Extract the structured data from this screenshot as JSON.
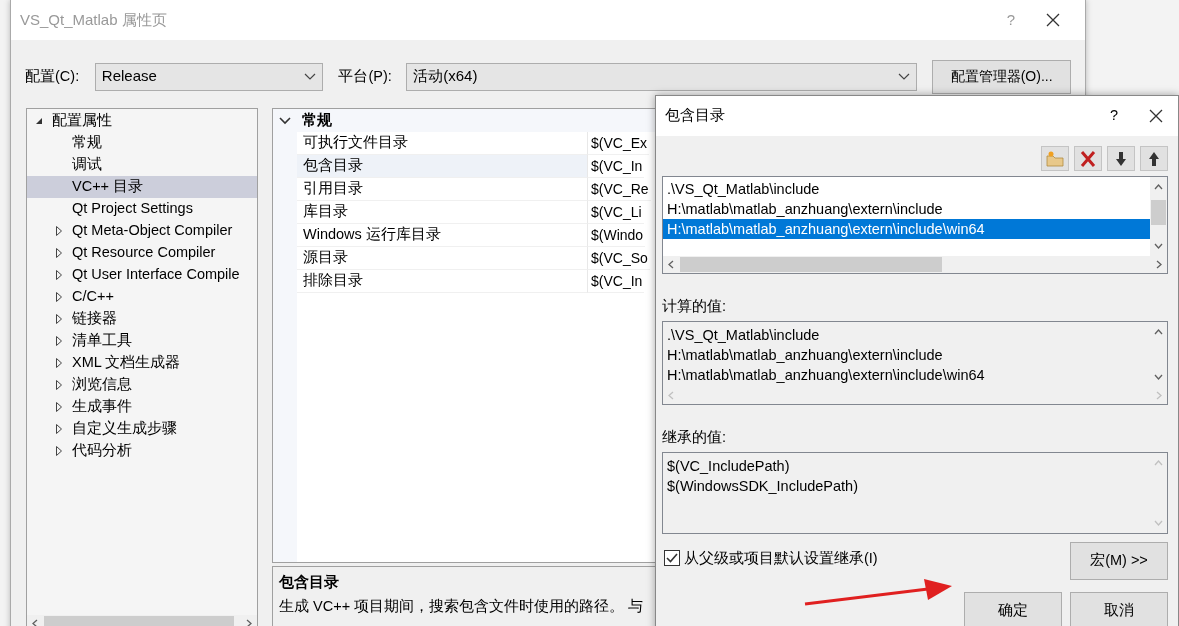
{
  "main_window": {
    "title": "VS_Qt_Matlab 属性页",
    "help": "?"
  },
  "config": {
    "config_label": "配置(C):",
    "config_value": "Release",
    "platform_label": "平台(P):",
    "platform_value": "活动(x64)",
    "manager_button": "配置管理器(O)..."
  },
  "tree": [
    {
      "label": "配置属性",
      "kind": "folder",
      "expanded": true,
      "selected": false,
      "children": [
        {
          "label": "常规",
          "kind": "leaf",
          "selected": false
        },
        {
          "label": "调试",
          "kind": "leaf",
          "selected": false
        },
        {
          "label": "VC++ 目录",
          "kind": "leaf",
          "selected": true
        },
        {
          "label": "Qt Project Settings",
          "kind": "leaf",
          "selected": false
        },
        {
          "label": "Qt Meta-Object Compiler",
          "kind": "folder",
          "expanded": false,
          "selected": false
        },
        {
          "label": "Qt Resource Compiler",
          "kind": "folder",
          "expanded": false,
          "selected": false
        },
        {
          "label": "Qt User Interface Compile",
          "kind": "folder",
          "expanded": false,
          "selected": false
        },
        {
          "label": "C/C++",
          "kind": "folder",
          "expanded": false,
          "selected": false
        },
        {
          "label": "链接器",
          "kind": "folder",
          "expanded": false,
          "selected": false
        },
        {
          "label": "清单工具",
          "kind": "folder",
          "expanded": false,
          "selected": false
        },
        {
          "label": "XML 文档生成器",
          "kind": "folder",
          "expanded": false,
          "selected": false
        },
        {
          "label": "浏览信息",
          "kind": "folder",
          "expanded": false,
          "selected": false
        },
        {
          "label": "生成事件",
          "kind": "folder",
          "expanded": false,
          "selected": false
        },
        {
          "label": "自定义生成步骤",
          "kind": "folder",
          "expanded": false,
          "selected": false
        },
        {
          "label": "代码分析",
          "kind": "folder",
          "expanded": false,
          "selected": false
        }
      ]
    }
  ],
  "property_grid": {
    "group": {
      "label": "常规",
      "expanded": true
    },
    "rows": [
      {
        "name": "可执行文件目录",
        "value": "$(VC_Ex",
        "selected": false
      },
      {
        "name": "包含目录",
        "value": "$(VC_In",
        "selected": true
      },
      {
        "name": "引用目录",
        "value": "$(VC_Re",
        "selected": false
      },
      {
        "name": "库目录",
        "value": "$(VC_Li",
        "selected": false
      },
      {
        "name": "Windows 运行库目录",
        "value": "$(Windo",
        "selected": false
      },
      {
        "name": "源目录",
        "value": "$(VC_So",
        "selected": false
      },
      {
        "name": "排除目录",
        "value": "$(VC_In",
        "selected": false
      }
    ]
  },
  "description": {
    "title": "包含目录",
    "text": "生成 VC++ 项目期间，搜索包含文件时使用的路径。 与"
  },
  "dialog": {
    "title": "包含目录",
    "help": "?",
    "entries": [
      {
        "text": ".\\VS_Qt_Matlab\\include",
        "selected": false
      },
      {
        "text": "H:\\matlab\\matlab_anzhuang\\extern\\include",
        "selected": false
      },
      {
        "text": "H:\\matlab\\matlab_anzhuang\\extern\\include\\win64",
        "selected": true
      }
    ],
    "computed_label": "计算的值:",
    "computed_values": [
      ".\\VS_Qt_Matlab\\include",
      "H:\\matlab\\matlab_anzhuang\\extern\\include",
      "H:\\matlab\\matlab_anzhuang\\extern\\include\\win64"
    ],
    "inherited_label": "继承的值:",
    "inherited_values": [
      "$(VC_IncludePath)",
      "$(WindowsSDK_IncludePath)"
    ],
    "inherit_checkbox": {
      "label": "从父级或项目默认设置继承(I)",
      "checked": true
    },
    "macro_button": "宏(M) >>",
    "ok_button": "确定",
    "cancel_button": "取消"
  }
}
